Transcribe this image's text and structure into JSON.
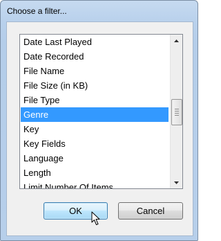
{
  "dialog": {
    "title": "Choose a filter..."
  },
  "list": {
    "items": [
      "Date Last Played",
      "Date Recorded",
      "File Name",
      "File Size (in KB)",
      "File Type",
      "Genre",
      "Key",
      "Key Fields",
      "Language",
      "Length",
      "Limit Number Of Items"
    ],
    "selected_index": 5
  },
  "buttons": {
    "ok_label": "OK",
    "cancel_label": "Cancel"
  },
  "icons": {
    "scroll_up": "scroll-up-arrow-icon",
    "scroll_down": "scroll-down-arrow-icon",
    "cursor": "mouse-pointer-icon"
  },
  "colors": {
    "selection": "#3399ff",
    "title_bar": "#b9d1ec"
  }
}
